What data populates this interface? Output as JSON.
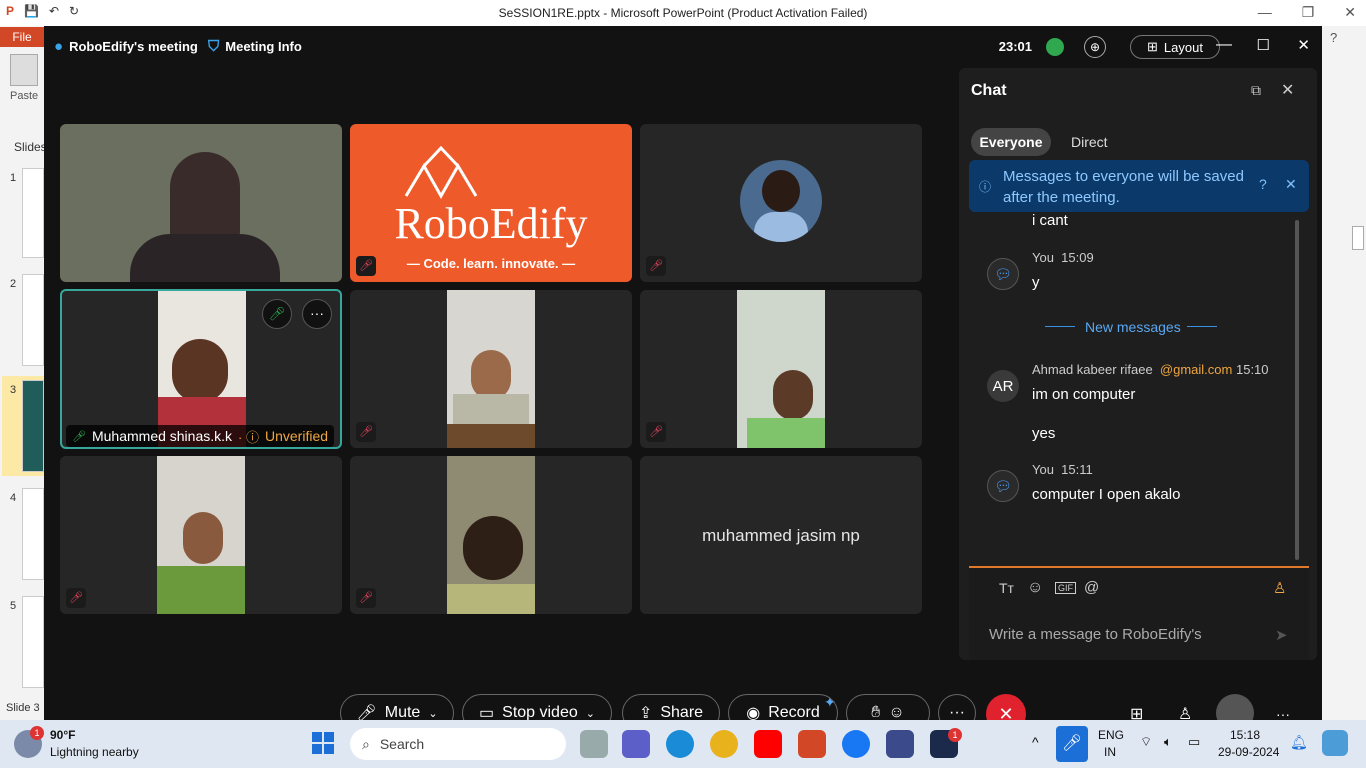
{
  "ppt": {
    "window_title": "SeSSION1RE.pptx  -  Microsoft PowerPoint (Product Activation Failed)",
    "file_tab": "File",
    "paste_label": "Paste",
    "slides_label": "Slides",
    "slide_numbers": [
      "1",
      "2",
      "3",
      "4",
      "5"
    ],
    "status": "Slide 3"
  },
  "webex": {
    "meeting_name": "RoboEdify's meeting",
    "meeting_info": "Meeting Info",
    "time": "23:01",
    "layout_label": "Layout",
    "tiles": {
      "logo_text": "RoboEdify",
      "logo_tagline": "— Code. learn. innovate. —",
      "active_name": "Muhammed shinas.k.k",
      "unverified": "Unverified",
      "camera_off_name": "muhammed jasim np"
    },
    "chat": {
      "title": "Chat",
      "tab_everyone": "Everyone",
      "tab_direct": "Direct",
      "banner": "Messages to everyone will be saved after the meeting.",
      "messages": [
        {
          "text": "i cant"
        },
        {
          "sender": "You",
          "time": "15:09",
          "text": "y"
        },
        {
          "divider": "New messages"
        },
        {
          "initials": "AR",
          "sender": "Ahmad kabeer rifaee",
          "email": "@gmail.com",
          "time": "15:10",
          "text": "im on computer",
          "text2": "yes"
        },
        {
          "sender": "You",
          "time": "15:11",
          "text": "computer I open akalo"
        }
      ],
      "input_placeholder": "Write a message to RoboEdify's"
    },
    "controls": {
      "mute": "Mute",
      "stop_video": "Stop video",
      "share": "Share",
      "record": "Record"
    }
  },
  "taskbar": {
    "weather_temp": "90°F",
    "weather_desc": "Lightning nearby",
    "weather_badge": "1",
    "search_placeholder": "Search",
    "lang_line1": "ENG",
    "lang_line2": "IN",
    "clock_time": "15:18",
    "clock_date": "29-09-2024",
    "webex_badge": "1"
  },
  "colors": {
    "webex_bg": "#121212",
    "tile_bg": "#262626",
    "accent_teal": "#35a89b",
    "roboedify_orange": "#ee5a2a",
    "mute_red": "#e0445b",
    "unverified_orange": "#f0a640",
    "banner_blue": "#0b3a6a",
    "end_red": "#e0222e"
  }
}
